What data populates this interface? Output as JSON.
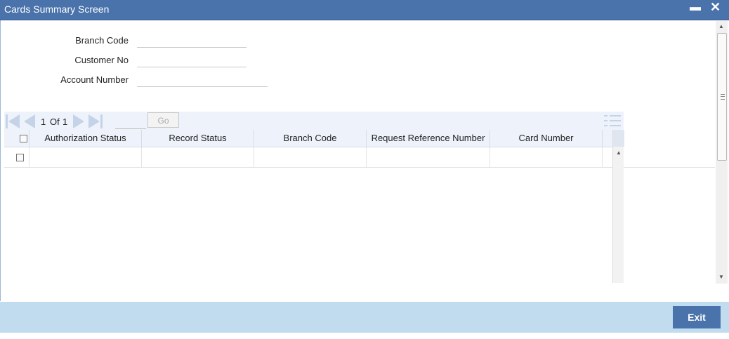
{
  "window": {
    "title": "Cards Summary Screen",
    "minimize_glyph": "▬",
    "close_glyph": "✕"
  },
  "search": {
    "branch_code_label": "Branch Code",
    "customer_no_label": "Customer No",
    "account_number_label": "Account Number",
    "branch_code_value": "",
    "customer_no_value": "",
    "account_number_value": ""
  },
  "pager": {
    "current": "1",
    "of_label": "Of",
    "total": "1",
    "go_label": "Go",
    "page_value": ""
  },
  "grid": {
    "columns": [
      "Authorization Status",
      "Record Status",
      "Branch Code",
      "Request Reference Number",
      "Card Number"
    ]
  },
  "footer": {
    "exit_label": "Exit"
  },
  "icons": {
    "minimize": "minimize-icon",
    "close": "close-icon",
    "first": "first-page-icon",
    "prev": "prev-page-icon",
    "next": "next-page-icon",
    "last": "last-page-icon",
    "columns": "column-list-icon"
  },
  "colors": {
    "titlebar": "#4a72ab",
    "footer": "#c1dcef",
    "accent_pale": "#c5d3e8",
    "exit_button": "#4a72ab"
  }
}
